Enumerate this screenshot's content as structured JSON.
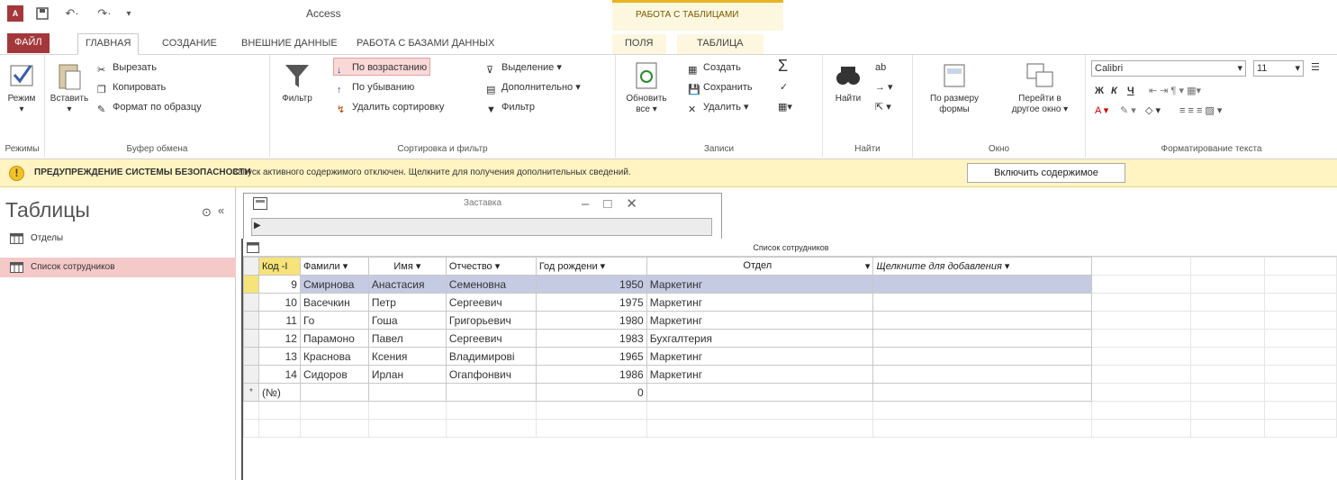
{
  "titlebar": {
    "app_title": "Access",
    "context_title": "РАБОТА С ТАБЛИЦАМИ"
  },
  "tabs": {
    "file": "ФАЙЛ",
    "home": "ГЛАВНАЯ",
    "create": "СОЗДАНИЕ",
    "external": "ВНЕШНИЕ ДАННЫЕ",
    "database": "РАБОТА С БАЗАМИ ДАННЫХ",
    "fields": "ПОЛЯ",
    "table": "ТАБЛИЦА"
  },
  "ribbon": {
    "views": {
      "mode": "Режим",
      "group": "Режимы"
    },
    "clipboard": {
      "paste": "Вставить",
      "cut": "Вырезать",
      "copy": "Копировать",
      "format_painter": "Формат по образцу",
      "group": "Буфер обмена"
    },
    "sort": {
      "filter": "Фильтр",
      "asc": "По возрастанию",
      "desc": "По убыванию",
      "remove_sort": "Удалить сортировку",
      "selection": "Выделение",
      "advanced": "Дополнительно",
      "toggle_filter": "Фильтр",
      "group": "Сортировка и фильтр"
    },
    "records": {
      "refresh": "Обновить",
      "refresh_all": "все",
      "new": "Создать",
      "save": "Сохранить",
      "delete": "Удалить",
      "group": "Записи"
    },
    "find": {
      "find": "Найти",
      "group": "Найти"
    },
    "window": {
      "fit": "По размеру",
      "fit2": "формы",
      "switch": "Перейти в",
      "switch2": "другое окно",
      "group": "Окно"
    },
    "text": {
      "font": "Calibri",
      "size": "11",
      "bold": "Ж",
      "italic": "К",
      "underline": "Ч",
      "group": "Форматирование текста"
    }
  },
  "security": {
    "title": "ПРЕДУПРЕЖДЕНИЕ СИСТЕМЫ БЕЗОПАСНОСТИ",
    "message": "Запуск активного содержимого отключен. Щелкните для получения дополнительных сведений.",
    "button": "Включить содержимое"
  },
  "nav": {
    "title": "Таблицы",
    "items": [
      {
        "label": "Отделы"
      },
      {
        "label": "Список сотрудников"
      }
    ]
  },
  "splash": {
    "title": "Заставка"
  },
  "datasheet": {
    "title": "Список сотрудников",
    "columns": [
      "Код",
      "Фамили",
      "Имя",
      "Отчество",
      "Год рождени",
      "Отдел",
      "Щелкните для добавления"
    ],
    "rows": [
      {
        "id": "9",
        "last": "Смирнова",
        "first": "Анастасия",
        "middle": "Семеновна",
        "year": "1950",
        "dept": "Маркетинг"
      },
      {
        "id": "10",
        "last": "Васечкин",
        "first": "Петр",
        "middle": "Сергеевич",
        "year": "1975",
        "dept": "Маркетинг"
      },
      {
        "id": "11",
        "last": "Го",
        "first": "Гоша",
        "middle": "Григорьевич",
        "year": "1980",
        "dept": "Маркетинг"
      },
      {
        "id": "12",
        "last": "Парамоно",
        "first": "Павел",
        "middle": "Сергеевич",
        "year": "1983",
        "dept": "Бухгалтерия"
      },
      {
        "id": "13",
        "last": "Краснова",
        "first": "Ксения",
        "middle": "Владимирові",
        "year": "1965",
        "dept": "Маркетинг"
      },
      {
        "id": "14",
        "last": "Сидоров",
        "first": "Ирлан",
        "middle": "Огапфонвич",
        "year": "1986",
        "dept": "Маркетинг"
      }
    ],
    "new_row": {
      "marker": "*",
      "id": "(№)",
      "year": "0"
    }
  }
}
